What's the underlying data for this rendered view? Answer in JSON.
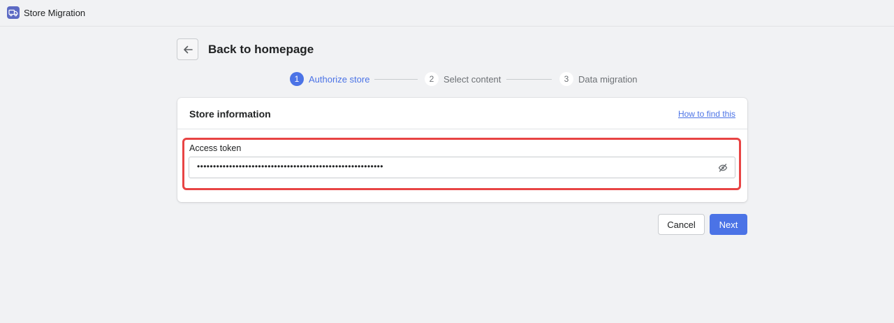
{
  "app": {
    "title": "Store Migration",
    "icon": "truck-icon",
    "accent_color": "#5c6ac4"
  },
  "header": {
    "back_icon": "arrow-left-icon",
    "title": "Back to homepage"
  },
  "stepper": {
    "steps": [
      {
        "number": "1",
        "label": "Authorize store",
        "state": "active"
      },
      {
        "number": "2",
        "label": "Select content",
        "state": "inactive"
      },
      {
        "number": "3",
        "label": "Data migration",
        "state": "inactive"
      }
    ],
    "active_color": "#4b73e6"
  },
  "card": {
    "title": "Store information",
    "help_link": "How to find this",
    "field": {
      "label": "Access token",
      "value": "••••••••••••••••••••••••••••••••••••••••••••••••••••••••••",
      "toggle_icon": "eye-slash-icon"
    },
    "highlight_color": "#e84444"
  },
  "footer": {
    "cancel_label": "Cancel",
    "next_label": "Next",
    "primary_color": "#4b73e6"
  }
}
